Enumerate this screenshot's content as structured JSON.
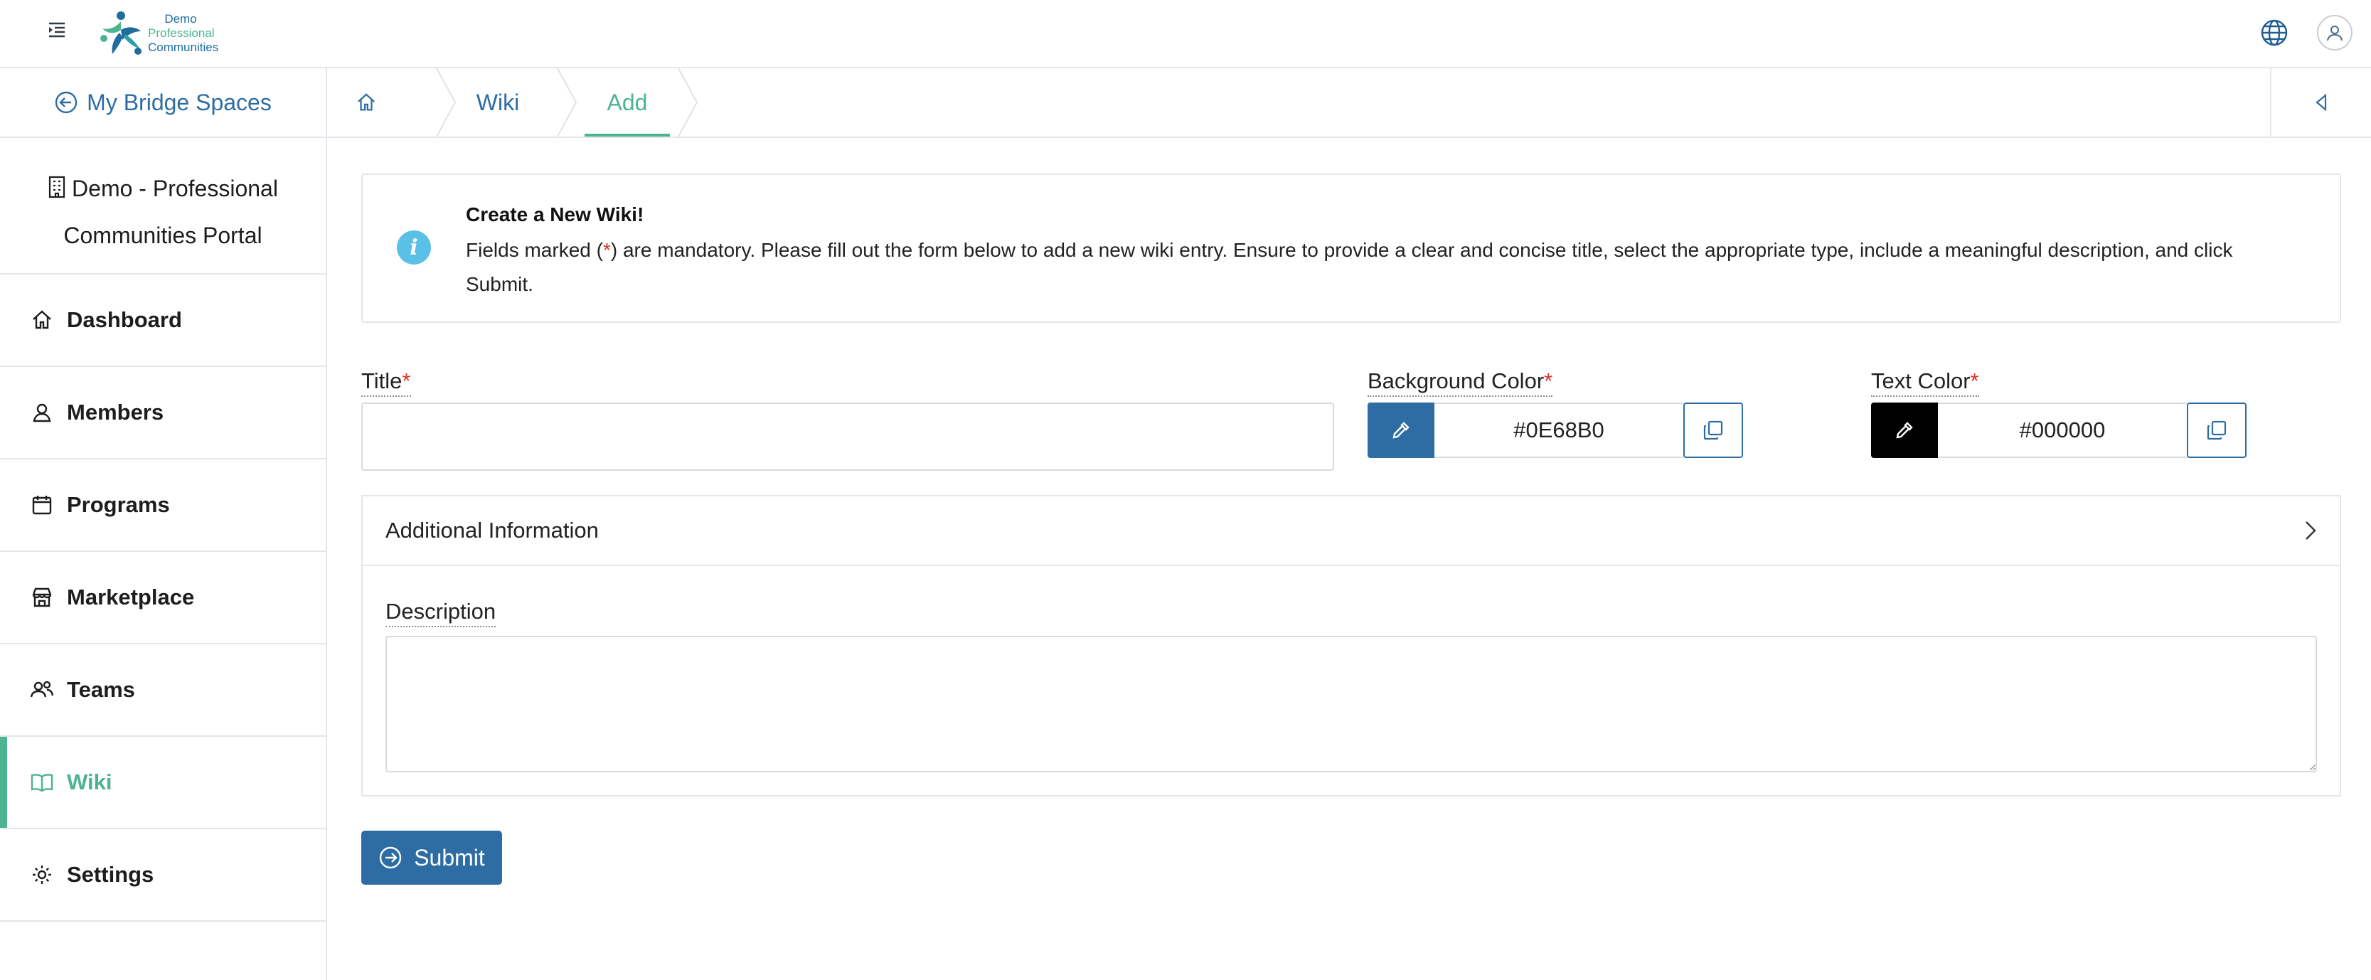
{
  "header": {
    "logo_lines": [
      "Demo",
      "Professional",
      "Communities"
    ],
    "menu_toggle_icon": "indent-menu-icon",
    "language_icon": "globe-icon",
    "user_icon": "user-avatar-icon"
  },
  "sidebar": {
    "back_label": "My Bridge Spaces",
    "org_name": "Demo - Professional Communities Portal",
    "items": [
      {
        "label": "Dashboard",
        "icon": "home-icon",
        "active": false
      },
      {
        "label": "Members",
        "icon": "user-icon",
        "active": false
      },
      {
        "label": "Programs",
        "icon": "calendar-icon",
        "active": false
      },
      {
        "label": "Marketplace",
        "icon": "store-icon",
        "active": false
      },
      {
        "label": "Teams",
        "icon": "users-icon",
        "active": false
      },
      {
        "label": "Wiki",
        "icon": "book-icon",
        "active": true
      },
      {
        "label": "Settings",
        "icon": "gear-icon",
        "active": false
      }
    ],
    "active_color": "#4cb48e"
  },
  "breadcrumb": {
    "home_icon": "home-icon",
    "items": [
      "Wiki",
      "Add"
    ],
    "collapse_icon": "triangle-left-icon"
  },
  "info": {
    "title": "Create a New Wiki!",
    "text_before": "Fields marked (",
    "required_mark": "*",
    "text_after": ") are mandatory. Please fill out the form below to add a new wiki entry. Ensure to provide a clear and concise title, select the appropriate type, include a meaningful description, and click Submit."
  },
  "form": {
    "title_label": "Title",
    "required_mark": "*",
    "title_value": "",
    "background_color_label": "Background Color",
    "background_color_value": "#0E68B0",
    "text_color_label": "Text Color",
    "text_color_value": "#000000",
    "additional_info_label": "Additional Information",
    "description_label": "Description",
    "description_value": "",
    "submit_label": "Submit"
  },
  "colors": {
    "primary": "#2e6da4",
    "accent_green": "#4cb48e",
    "info_blue": "#5bc0e7",
    "picker_bg": "#2e6da4",
    "picker_text": "#000000"
  }
}
